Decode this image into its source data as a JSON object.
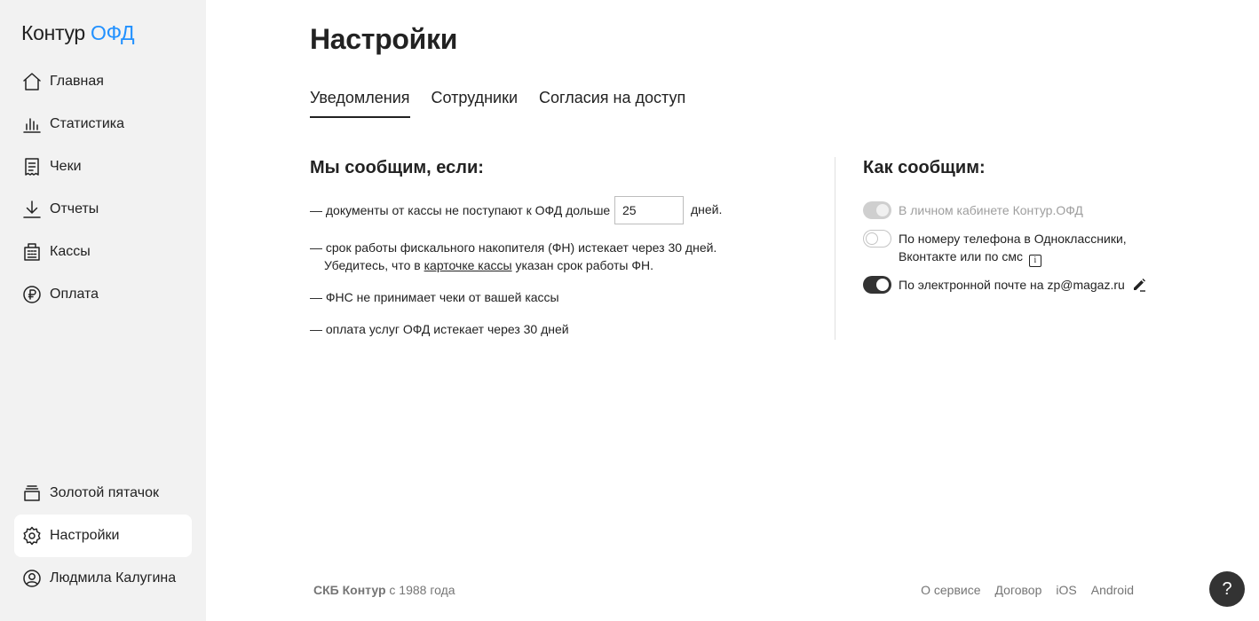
{
  "app": {
    "logo_main": "Контур",
    "logo_accent": "ОФД"
  },
  "sidebar": {
    "items": [
      {
        "label": "Главная",
        "icon": "home-icon"
      },
      {
        "label": "Статистика",
        "icon": "bar-chart-icon"
      },
      {
        "label": "Чеки",
        "icon": "receipt-icon"
      },
      {
        "label": "Отчеты",
        "icon": "download-icon"
      },
      {
        "label": "Кассы",
        "icon": "cash-register-icon"
      },
      {
        "label": "Оплата",
        "icon": "ruble-coin-icon"
      }
    ],
    "bottom_items": [
      {
        "label": "Золотой пятачок",
        "icon": "coin-stack-icon"
      },
      {
        "label": "Настройки",
        "icon": "gear-icon",
        "active": true
      },
      {
        "label": "Людмила Калугина",
        "icon": "user-icon"
      }
    ]
  },
  "main": {
    "title": "Настройки",
    "tabs": [
      {
        "label": "Уведомления",
        "active": true
      },
      {
        "label": "Сотрудники"
      },
      {
        "label": "Согласия на доступ"
      }
    ],
    "conditions": {
      "title": "Мы сообщим, если:",
      "doc_delay_prefix": "— документы от кассы не поступают к ОФД дольше",
      "doc_delay_value": "25",
      "doc_delay_suffix": "дней.",
      "fn_line1": "— срок работы фискального накопителя (ФН) истекает через 30 дней.",
      "fn_line2_prefix": "Убедитесь, что в",
      "fn_line2_link": "карточке кассы",
      "fn_line2_suffix": "указан срок работы ФН.",
      "fns_reject": "— ФНС не принимает чеки от вашей кассы",
      "payment_expiry": "— оплата услуг ОФД истекает через 30 дней"
    },
    "channels": {
      "title": "Как сообщим:",
      "cabinet": {
        "label": "В личном кабинете Контур.ОФД",
        "state": "on-disabled"
      },
      "phone": {
        "label_line1": "По номеру телефона в Одноклассники,",
        "label_line2": "Вконтакте или по смс",
        "info": "i",
        "state": "off"
      },
      "email": {
        "label": "По электронной почте на zp@magaz.ru",
        "state": "on"
      }
    }
  },
  "footer": {
    "brand": "СКБ Контур",
    "since": "с 1988 года",
    "links": [
      "О сервисе",
      "Договор",
      "iOS",
      "Android"
    ]
  },
  "help": {
    "label": "?"
  }
}
